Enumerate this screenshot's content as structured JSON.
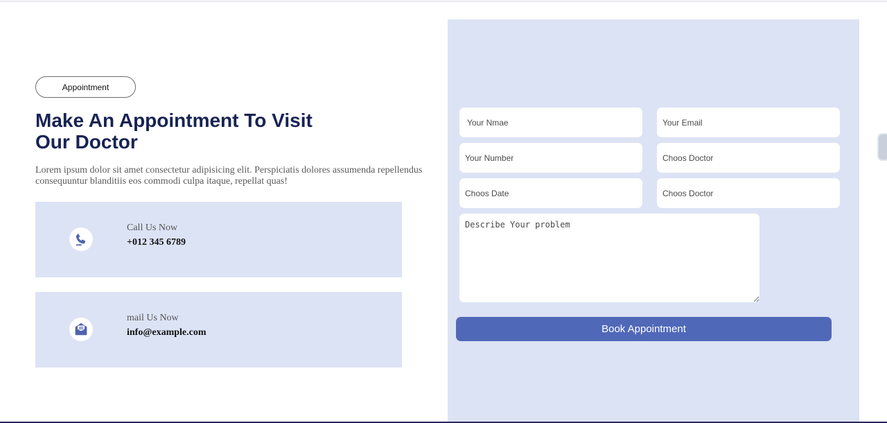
{
  "section": {
    "badge": "Appointment",
    "title": "Make An Appointment To Visit Our Doctor",
    "description": "Lorem ipsum dolor sit amet consectetur adipisicing elit. Perspiciatis dolores assumenda repellendus consequuntur blanditiis eos commodi culpa itaque, repellat quas!"
  },
  "contacts": [
    {
      "label": "Call Us Now",
      "value": "+012 345 6789",
      "icon": "phone-icon"
    },
    {
      "label": "mail Us Now",
      "value": "info@example.com",
      "icon": "envelope-icon"
    }
  ],
  "form": {
    "name_placeholder": "Your Nmae",
    "email_placeholder": "Your Email",
    "number_placeholder": "Your Number",
    "doctor_placeholder_1": "Choos Doctor",
    "date_placeholder": "Choos Date",
    "doctor_placeholder_2": "Choos Doctor",
    "problem_placeholder": "Describe Your problem",
    "submit_label": "Book Appointment"
  },
  "colors": {
    "accent": "#5068b8",
    "panel": "#dce3f4",
    "heading": "#172353"
  }
}
